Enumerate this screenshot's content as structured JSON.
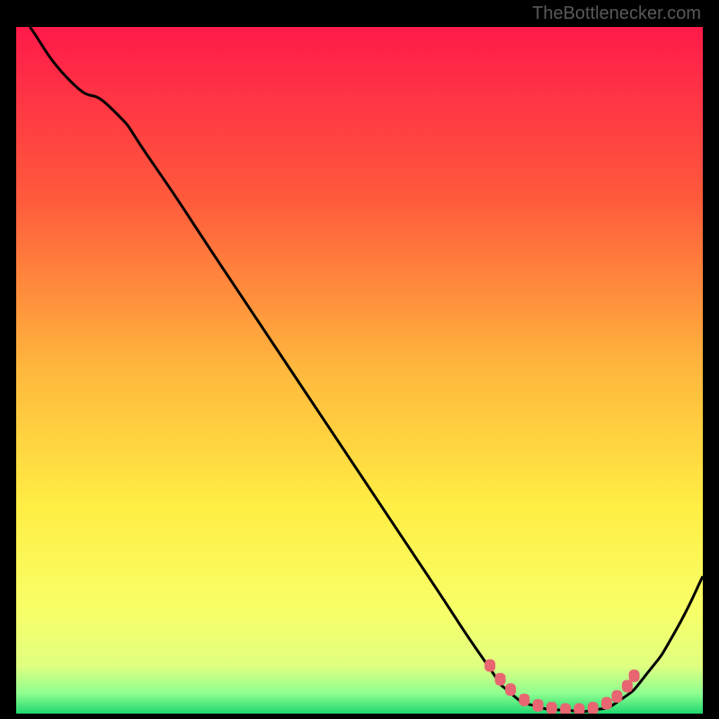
{
  "watermark": "TheBottlenecker.com",
  "chart_data": {
    "type": "line",
    "title": "",
    "xlabel": "",
    "ylabel": "",
    "xlim": [
      0,
      100
    ],
    "ylim": [
      0,
      100
    ],
    "gradient_colors": [
      {
        "stop": 0,
        "color": "#ff1a4a"
      },
      {
        "stop": 0.25,
        "color": "#ff5a3c"
      },
      {
        "stop": 0.5,
        "color": "#ffb83d"
      },
      {
        "stop": 0.7,
        "color": "#ffee44"
      },
      {
        "stop": 0.85,
        "color": "#f8ff68"
      },
      {
        "stop": 0.93,
        "color": "#e0ff80"
      },
      {
        "stop": 0.97,
        "color": "#90ff90"
      },
      {
        "stop": 1.0,
        "color": "#20d870"
      }
    ],
    "curve_points": [
      {
        "x": 2,
        "y": 100
      },
      {
        "x": 8,
        "y": 92
      },
      {
        "x": 14,
        "y": 88
      },
      {
        "x": 20,
        "y": 80
      },
      {
        "x": 30,
        "y": 65
      },
      {
        "x": 40,
        "y": 50
      },
      {
        "x": 50,
        "y": 35
      },
      {
        "x": 60,
        "y": 20
      },
      {
        "x": 68,
        "y": 8
      },
      {
        "x": 72,
        "y": 3
      },
      {
        "x": 76,
        "y": 1
      },
      {
        "x": 80,
        "y": 0.5
      },
      {
        "x": 84,
        "y": 0.5
      },
      {
        "x": 88,
        "y": 2
      },
      {
        "x": 92,
        "y": 6
      },
      {
        "x": 96,
        "y": 12
      },
      {
        "x": 100,
        "y": 20
      }
    ],
    "marker_points": [
      {
        "x": 69,
        "y": 7
      },
      {
        "x": 70.5,
        "y": 5
      },
      {
        "x": 72,
        "y": 3.5
      },
      {
        "x": 74,
        "y": 2
      },
      {
        "x": 76,
        "y": 1.2
      },
      {
        "x": 78,
        "y": 0.8
      },
      {
        "x": 80,
        "y": 0.6
      },
      {
        "x": 82,
        "y": 0.6
      },
      {
        "x": 84,
        "y": 0.8
      },
      {
        "x": 86,
        "y": 1.5
      },
      {
        "x": 87.5,
        "y": 2.5
      },
      {
        "x": 89,
        "y": 4
      },
      {
        "x": 90,
        "y": 5.5
      }
    ],
    "marker_color": "#e86672"
  }
}
